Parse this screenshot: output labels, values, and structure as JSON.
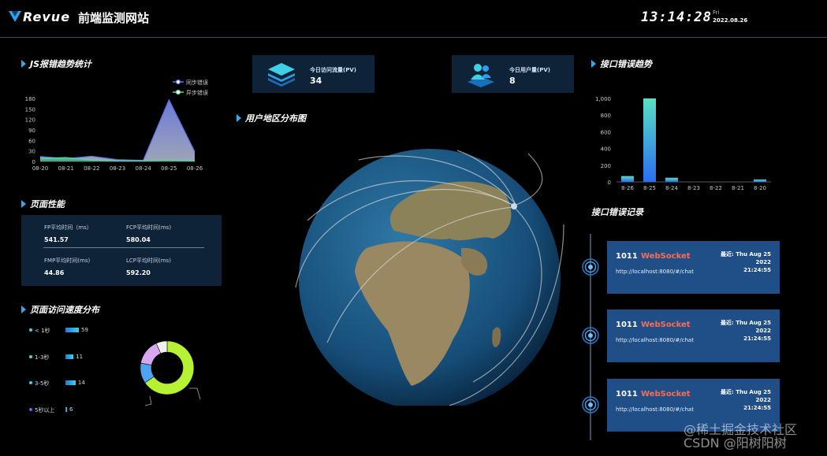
{
  "header": {
    "brand": "Revue",
    "site_title": "前端监测网站",
    "clock": "13:14:28",
    "weekday": "Fri",
    "date": "2022.08.26"
  },
  "sections": {
    "js_trend": "JS报错趋势统计",
    "perf": "页面性能",
    "speed": "页面访问速度分布",
    "map": "用户地区分布图",
    "api_trend": "接口错误趋势",
    "api_log": "接口错误记录"
  },
  "stats": {
    "pv_label": "今日访问流量(PV)",
    "pv_value": "34",
    "uv_label": "今日用户量(PV)",
    "uv_value": "8"
  },
  "perf": {
    "fp_label": "FP平均时间（ms）",
    "fp_value": "541.57",
    "fcp_label": "FCP平均时间(ms)",
    "fcp_value": "580.04",
    "fmp_label": "FMP平均时间(ms)",
    "fmp_value": "44.86",
    "lcp_label": "LCP平均时间(ms)",
    "lcp_value": "592.20"
  },
  "speed": {
    "items": [
      {
        "label": "< 1秒",
        "value": "59"
      },
      {
        "label": "1-3秒",
        "value": "11"
      },
      {
        "label": "3-5秒",
        "value": "14"
      },
      {
        "label": "5秒以上",
        "value": "6"
      }
    ]
  },
  "error_log": [
    {
      "code": "1011",
      "type": "WebSocket",
      "time_line1": "最近: Thu Aug 25 2022",
      "time_line2": "21:24:55",
      "url": "http://localhost:8080/#/chat"
    },
    {
      "code": "1011",
      "type": "WebSocket",
      "time_line1": "最近: Thu Aug 25 2022",
      "time_line2": "21:24:55",
      "url": "http://localhost:8080/#/chat"
    },
    {
      "code": "1011",
      "type": "WebSocket",
      "time_line1": "最近: Thu Aug 25 2022",
      "time_line2": "21:24:55",
      "url": "http://localhost:8080/#/chat"
    }
  ],
  "watermark": {
    "line1": "@稀土掘金技术社区",
    "line2": "CSDN @阳树阳树"
  },
  "colors": {
    "accent": "#38a7e8",
    "panel": "#0e2238",
    "card": "#1f4f86",
    "error_type": "#ff6b52",
    "sync_series": "#5b6ee1",
    "async_series": "#59d8a6"
  },
  "chart_data": [
    {
      "type": "area",
      "categories": [
        "08-20",
        "08-21",
        "08-22",
        "08-23",
        "08-24",
        "08-25",
        "08-26"
      ],
      "yticks": [
        0,
        30,
        60,
        90,
        120,
        150,
        180
      ],
      "ylim": [
        0,
        180
      ],
      "series": [
        {
          "name": "同步错误",
          "values": [
            14,
            8,
            15,
            5,
            3,
            176,
            28
          ]
        },
        {
          "name": "异步错误",
          "values": [
            9,
            11,
            4,
            2,
            2,
            4,
            2
          ]
        }
      ],
      "legend": "top-right"
    },
    {
      "type": "bar",
      "categories": [
        "8-26",
        "8-25",
        "8-24",
        "8-23",
        "8-22",
        "8-21",
        "8-20"
      ],
      "values": [
        70,
        1000,
        50,
        0,
        0,
        0,
        30
      ],
      "yticks": [
        0,
        200,
        400,
        600,
        800,
        "1,000"
      ],
      "ylim": [
        0,
        1000
      ]
    },
    {
      "type": "pie",
      "categories": [
        "< 1秒",
        "1-3秒",
        "3-5秒",
        "5秒以上"
      ],
      "values": [
        59,
        11,
        14,
        6
      ],
      "colors": [
        "#b6f233",
        "#4ea3f2",
        "#d7a8f0",
        "#f0f0f0"
      ]
    }
  ]
}
